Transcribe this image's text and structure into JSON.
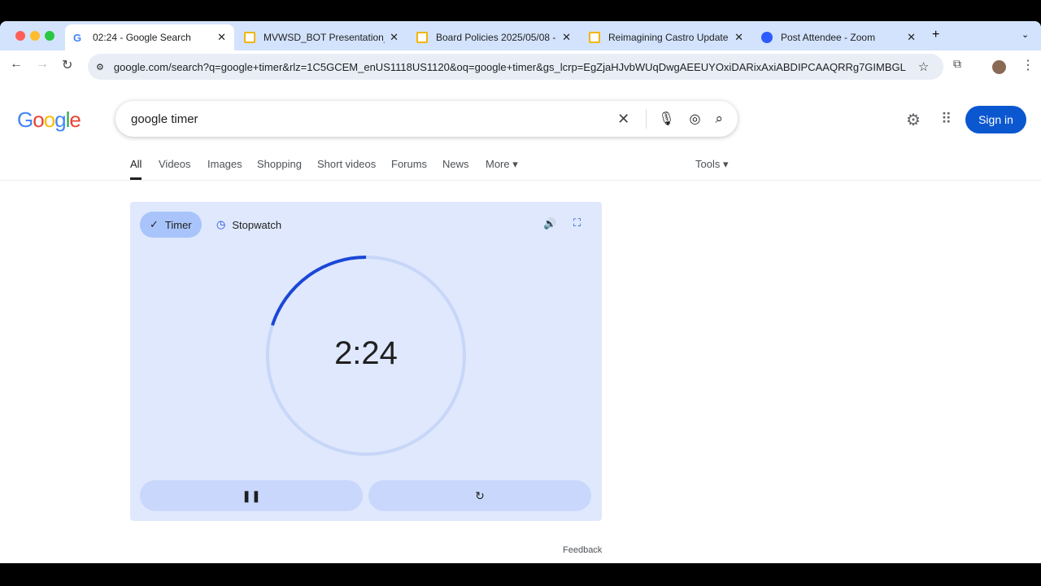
{
  "tabs": [
    {
      "title": "02:24 - Google Search",
      "active": true,
      "icon": "google-icon"
    },
    {
      "title": "MVWSD_BOT Presentation_R",
      "icon": "slides-icon"
    },
    {
      "title": "Board Policies 2025/05/08 -",
      "icon": "slides-icon"
    },
    {
      "title": "Reimagining Castro Update M",
      "icon": "slides-icon"
    },
    {
      "title": "Post Attendee - Zoom",
      "icon": "zoom-icon"
    }
  ],
  "url": "google.com/search?q=google+timer&rlz=1C5GCEM_enUS1118US1120&oq=google+timer&gs_lcrp=EgZjaHJvbWUqDwgAEEUYOxiDARixAxiABDIPCAAQRRg7GIMBGL...",
  "search": {
    "query": "google timer",
    "signin": "Sign in"
  },
  "nav": [
    "All",
    "Videos",
    "Images",
    "Shopping",
    "Short videos",
    "Forums",
    "News",
    "More"
  ],
  "tools": "Tools",
  "timer": {
    "timer_label": "Timer",
    "stopwatch_label": "Stopwatch",
    "time": "2:24",
    "remaining_fraction": 0.2,
    "feedback": "Feedback"
  },
  "colors": {
    "accent": "#1a47d6",
    "signin": "#0b57d0"
  }
}
